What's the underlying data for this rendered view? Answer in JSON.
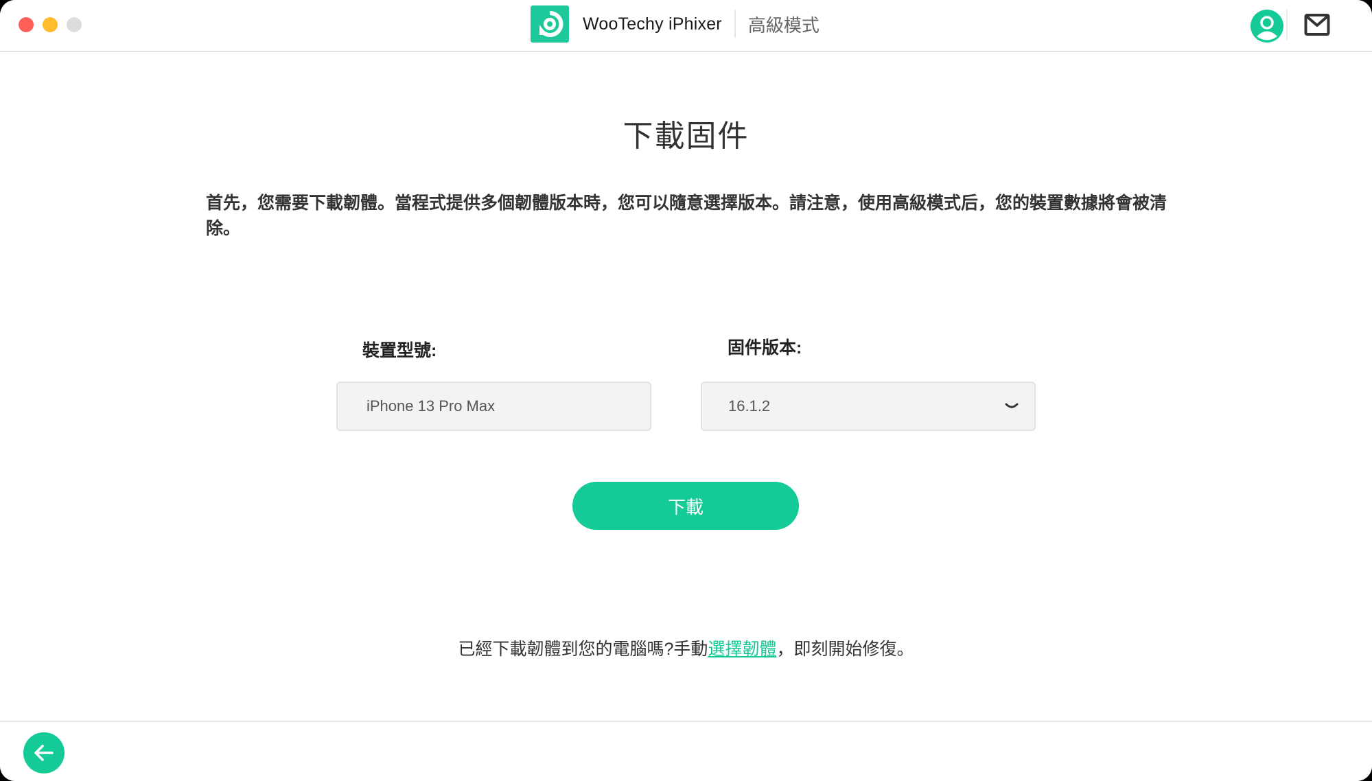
{
  "window": {
    "controls": [
      "close",
      "minimize",
      "maximize"
    ]
  },
  "header": {
    "app_name": "WooTechy iPhixer",
    "mode": "高級模式",
    "logo_icon": "iphixer-logo-icon",
    "account_icon": "user-account-icon",
    "mail_icon": "mail-icon"
  },
  "main": {
    "title": "下載固件",
    "description": "首先，您需要下載韌體。當程式提供多個韌體版本時，您可以隨意選擇版本。請注意，使用高級模式后，您的裝置數據將會被清除。",
    "device_model": {
      "label": "裝置型號:",
      "value": "iPhone 13 Pro Max"
    },
    "firmware_version": {
      "label": "固件版本:",
      "selected": "16.1.2"
    },
    "download_button": "下載",
    "footer_note": {
      "prefix": "已經下載韌體到您的電腦嗎?手動",
      "link": "選擇韌體",
      "suffix": "，即刻開始修復。"
    }
  },
  "footer": {
    "back_icon": "arrow-left-icon"
  },
  "colors": {
    "accent": "#14cb98",
    "close": "#fe5f57",
    "minimize": "#febc2e",
    "maximize": "#dcdcdc"
  }
}
